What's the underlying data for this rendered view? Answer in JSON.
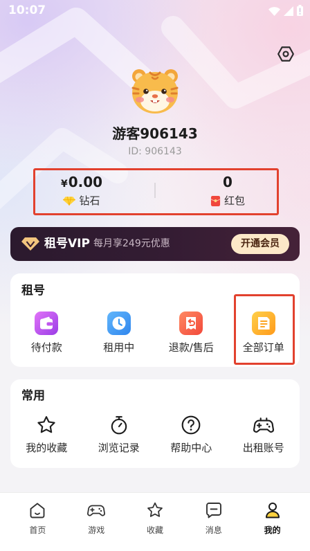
{
  "status_bar": {
    "time": "10:07",
    "icons": [
      "wifi-icon",
      "signal-icon",
      "battery-icon"
    ]
  },
  "header": {
    "settings_icon": "settings-hexagon-icon"
  },
  "profile": {
    "avatar_icon": "tiger-avatar",
    "username": "游客906143",
    "id_text": "ID: 906143"
  },
  "stats": {
    "diamonds": {
      "currency": "¥",
      "value": "0.00",
      "label": "钻石",
      "icon": "diamond-icon"
    },
    "red_packets": {
      "value": "0",
      "label": "红包",
      "icon": "red-envelope-icon"
    }
  },
  "vip_banner": {
    "title": "租号VIP",
    "description": "每月享249元优惠",
    "button_label": "开通会员",
    "icon": "vip-diamond-icon"
  },
  "rent_section": {
    "title": "租号",
    "items": [
      {
        "label": "待付款",
        "icon": "wallet-icon",
        "color": "#b44ef2"
      },
      {
        "label": "租用中",
        "icon": "clock-icon",
        "color": "#3d9cf5"
      },
      {
        "label": "退款/售后",
        "icon": "refund-icon",
        "color": "#f8603f"
      },
      {
        "label": "全部订单",
        "icon": "orders-icon",
        "color": "#fdb22a"
      }
    ]
  },
  "common_section": {
    "title": "常用",
    "items": [
      {
        "label": "我的收藏",
        "icon": "star-icon"
      },
      {
        "label": "浏览记录",
        "icon": "stopwatch-icon"
      },
      {
        "label": "帮助中心",
        "icon": "help-circle-icon"
      },
      {
        "label": "出租账号",
        "icon": "gamepad-icon"
      }
    ]
  },
  "bottom_nav": {
    "items": [
      {
        "label": "首页",
        "icon": "home-icon",
        "active": false
      },
      {
        "label": "游戏",
        "icon": "gamepad-icon",
        "active": false
      },
      {
        "label": "收藏",
        "icon": "star-icon",
        "active": false
      },
      {
        "label": "消息",
        "icon": "message-icon",
        "active": false
      },
      {
        "label": "我的",
        "icon": "person-icon",
        "active": true
      }
    ]
  },
  "colors": {
    "highlight_border": "#e2412e",
    "vip_background": "#2e1c2f",
    "vip_button": "#fce8c8",
    "active_nav": "#ffd23f",
    "page_background": "#f4f3f6"
  }
}
